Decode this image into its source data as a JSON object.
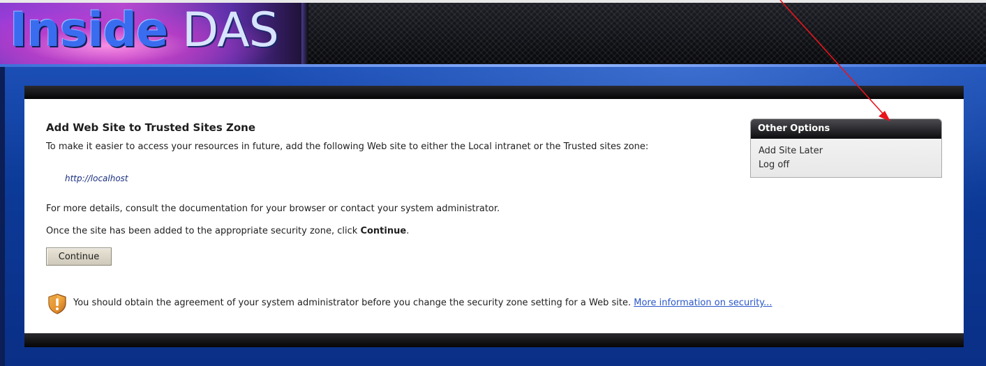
{
  "header": {
    "logo_part1": "Inside",
    "logo_part2": "DAS"
  },
  "main": {
    "title": "Add Web Site to Trusted Sites Zone",
    "intro": "To make it easier to access your resources in future, add the following Web site to either the Local intranet or the Trusted sites zone:",
    "site_url": "http://localhost",
    "details": "For more details, consult the documentation for your browser or contact your system administrator.",
    "once_prefix": "Once the site has been added to the appropriate security zone, click ",
    "once_bold": "Continue",
    "once_suffix": ".",
    "continue_label": "Continue",
    "warning_text": "You should obtain the agreement of your system administrator before you change the security zone setting for a Web site.",
    "security_link": "More information on security..."
  },
  "other_options": {
    "title": "Other Options",
    "items": [
      {
        "label": "Add Site Later"
      },
      {
        "label": "Log off"
      }
    ]
  },
  "icons": {
    "warning": "shield-warning-icon",
    "annotation": "red-arrow"
  },
  "colors": {
    "header_dark": "#0d0d10",
    "blue_background": "#0c3a98",
    "link": "#2a57c8",
    "url": "#1a2f80",
    "arrow": "#e8141c"
  }
}
